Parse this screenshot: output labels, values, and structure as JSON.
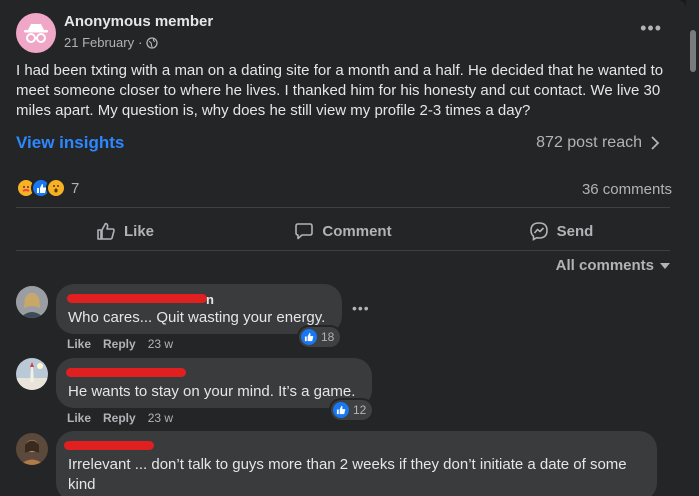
{
  "post": {
    "author": "Anonymous member",
    "date": "21 February",
    "dot": "·",
    "text": "I had been txting with  a man on a dating site for a month and a half. He decided that he wanted to meet someone closer to where he lives. I thanked him for his honesty and cut contact. We live 30 miles apart. My question is, why does he still view my profile 2-3 times a day?",
    "view_insights": "View insights",
    "reach": "872 post reach",
    "reaction_count": "7",
    "comments_count": "36 comments"
  },
  "actions": {
    "like": "Like",
    "comment": "Comment",
    "send": "Send"
  },
  "all_comments": "All comments",
  "comments": [
    {
      "name_visible": "n",
      "text": "Who cares... Quit wasting your energy.",
      "like": "Like",
      "reply": "Reply",
      "age": "23 w",
      "likes": "18"
    },
    {
      "name_visible": "",
      "text": "He wants to stay on your mind. It’s a game.",
      "like": "Like",
      "reply": "Reply",
      "age": "23 w",
      "likes": "12"
    },
    {
      "name_visible": "",
      "text": "Irrelevant ... don’t talk to guys more than 2 weeks if they don’t initiate a date of some kind"
    }
  ],
  "colors": {
    "accent": "#2d88ff",
    "like_blue": "#1877f2",
    "redaction": "#e02020",
    "card": "#242526",
    "bubble": "#3a3b3c"
  }
}
